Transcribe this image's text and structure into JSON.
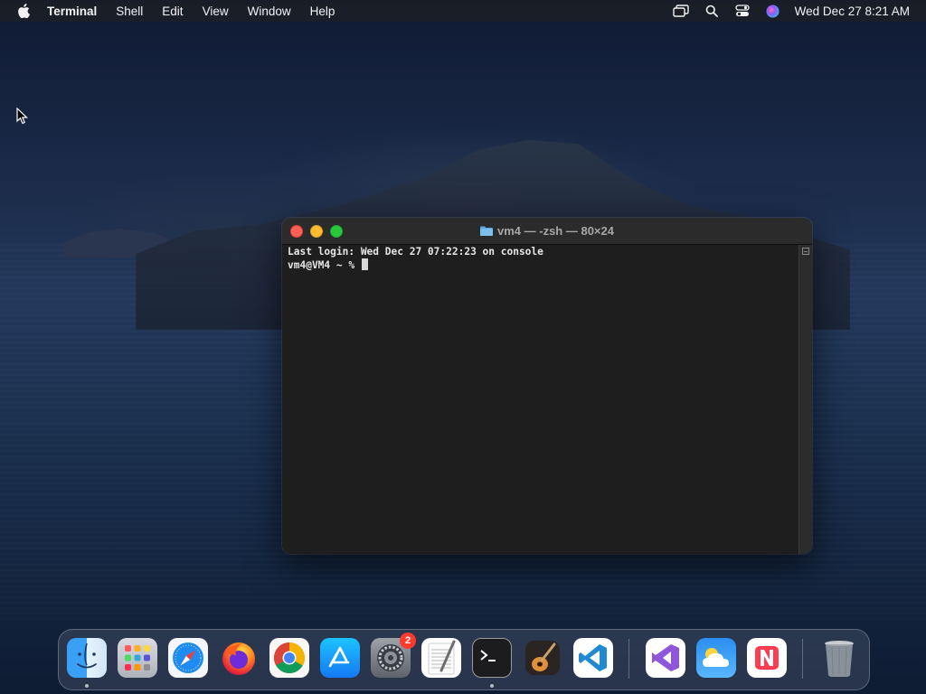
{
  "menubar": {
    "apple_icon": "apple-icon",
    "app_name": "Terminal",
    "items": [
      "Shell",
      "Edit",
      "View",
      "Window",
      "Help"
    ],
    "status_icons": [
      "screen-mirroring-icon",
      "spotlight-search-icon",
      "control-center-icon",
      "siri-icon"
    ],
    "clock": "Wed Dec 27  8:21 AM"
  },
  "terminal": {
    "title": "vm4 — -zsh — 80×24",
    "title_icon": "folder-icon",
    "lines": [
      "Last login: Wed Dec 27 07:22:23 on console",
      "vm4@VM4 ~ % "
    ]
  },
  "dock": {
    "apps": [
      {
        "name": "Finder",
        "icon": "finder-icon",
        "running": true
      },
      {
        "name": "Launchpad",
        "icon": "launchpad-icon",
        "running": false
      },
      {
        "name": "Safari",
        "icon": "safari-icon",
        "running": false
      },
      {
        "name": "Firefox",
        "icon": "firefox-icon",
        "running": false
      },
      {
        "name": "Google Chrome",
        "icon": "chrome-icon",
        "running": false
      },
      {
        "name": "App Store",
        "icon": "app-store-icon",
        "running": false
      },
      {
        "name": "System Settings",
        "icon": "system-settings-icon",
        "running": false,
        "badge": "2"
      },
      {
        "name": "TextEdit",
        "icon": "textedit-icon",
        "running": false
      },
      {
        "name": "Terminal",
        "icon": "terminal-icon",
        "running": true
      },
      {
        "name": "GarageBand",
        "icon": "garageband-icon",
        "running": false
      },
      {
        "name": "Visual Studio Code",
        "icon": "vscode-icon",
        "running": false
      },
      {
        "name": "Visual Studio",
        "icon": "visual-studio-icon",
        "running": false
      },
      {
        "name": "Weather",
        "icon": "weather-icon",
        "running": false
      },
      {
        "name": "News",
        "icon": "news-icon",
        "running": false
      },
      {
        "name": "Trash",
        "icon": "trash-icon",
        "running": false
      }
    ]
  }
}
